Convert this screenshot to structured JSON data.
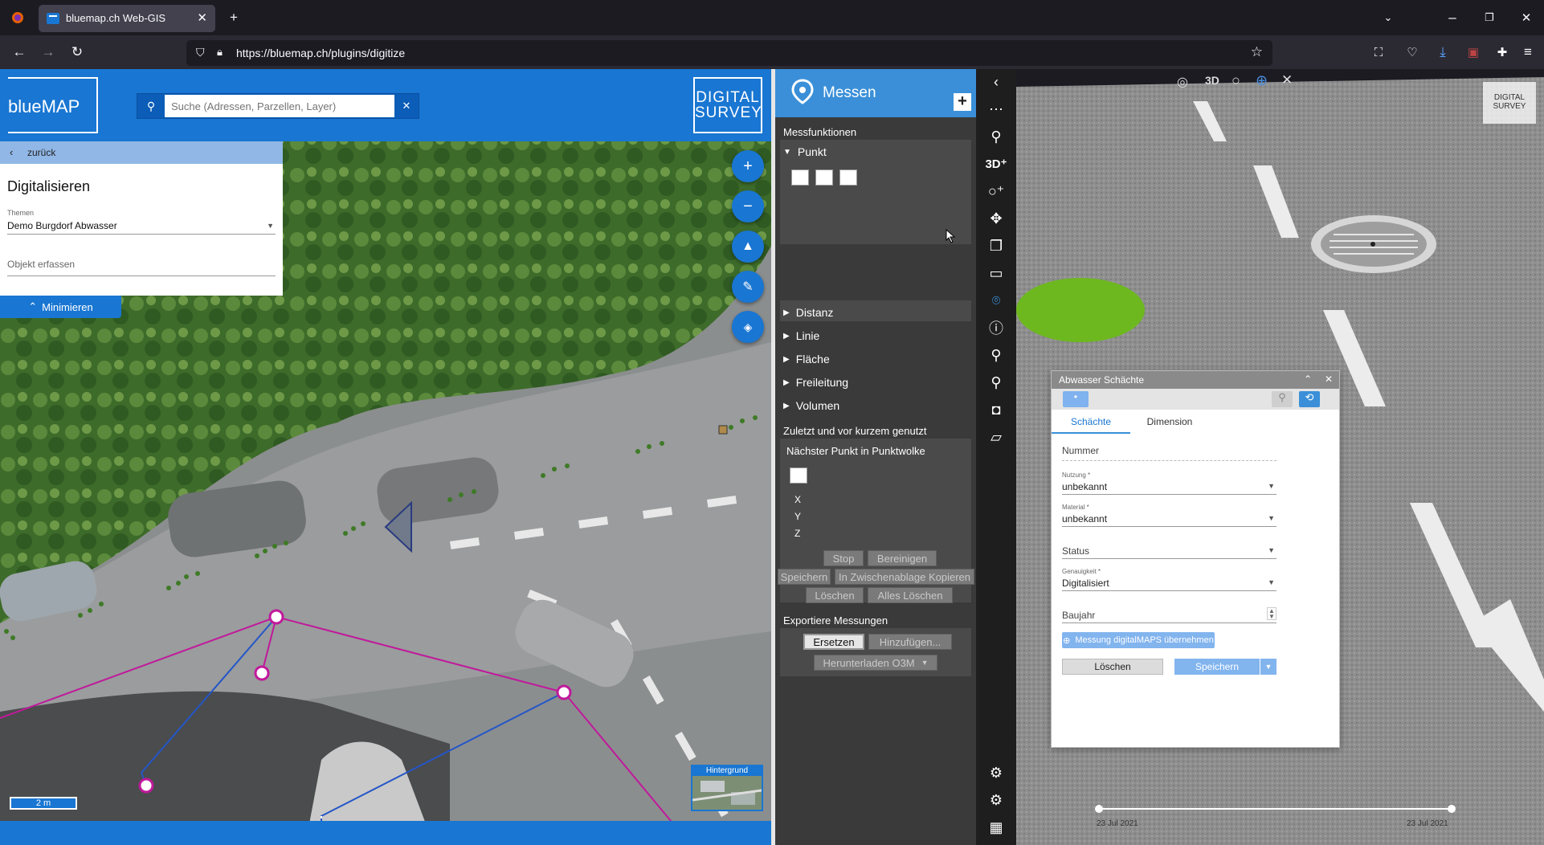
{
  "browser": {
    "tab_title": "bluemap.ch Web-GIS",
    "url": "https://bluemap.ch/plugins/digitize"
  },
  "header": {
    "logo": "blueMAP",
    "search_placeholder": "Suche (Adressen, Parzellen, Layer)",
    "brand_line1": "DIGITAL",
    "brand_line2": "SURVEY"
  },
  "digitize_panel": {
    "back": "zurück",
    "title": "Digitalisieren",
    "themen_label": "Themen",
    "themen_value": "Demo Burgdorf Abwasser",
    "object_placeholder": "Objekt erfassen",
    "minimize": "Minimieren"
  },
  "map": {
    "scale": "2 m",
    "background_label": "Hintergrund"
  },
  "measure_panel": {
    "title": "Messen",
    "section_functions": "Messfunktionen",
    "point": "Punkt",
    "items": [
      "Distanz",
      "Linie",
      "Fläche",
      "Freileitung",
      "Volumen"
    ],
    "recent_title": "Zuletzt und vor kurzem genutzt",
    "nearest_point": "Nächster Punkt in Punktwolke",
    "x": "X",
    "y": "Y",
    "z": "Z",
    "btn_stop": "Stop",
    "btn_bereinigen": "Bereinigen",
    "btn_speichern": "Speichern",
    "btn_clipboard": "In Zwischenablage Kopieren",
    "btn_loeschen": "Löschen",
    "btn_alles_loeschen": "Alles Löschen",
    "export_title": "Exportiere Messungen",
    "btn_ersetzen": "Ersetzen",
    "btn_hinzufuegen": "Hinzufügen...",
    "btn_download": "Herunterladen O3M"
  },
  "view3d": {
    "toolbar_3d": "3D",
    "logo_line1": "DIGITAL",
    "logo_line2": "SURVEY",
    "timeline_start": "23 Jul 2021",
    "timeline_end": "23 Jul 2021"
  },
  "form": {
    "title": "Abwasser Schächte",
    "tab_schaechte": "Schächte",
    "tab_dimension": "Dimension",
    "nummer_label": "Nummer",
    "nutzung_label": "Nutzung *",
    "nutzung_value": "unbekannt",
    "material_label": "Material *",
    "material_value": "unbekannt",
    "status_label": "Status",
    "genauigkeit_label": "Genauigkeit *",
    "genauigkeit_value": "Digitalisiert",
    "baujahr_label": "Baujahr",
    "messung_button": "Messung digitalMAPS übernehmen",
    "delete_button": "Löschen",
    "save_button": "Speichern"
  },
  "colors": {
    "brand_blue": "#1976d2",
    "panel_dark": "#3a3a3a",
    "magenta_line": "#c0199b",
    "blue_line": "#2456c8"
  }
}
